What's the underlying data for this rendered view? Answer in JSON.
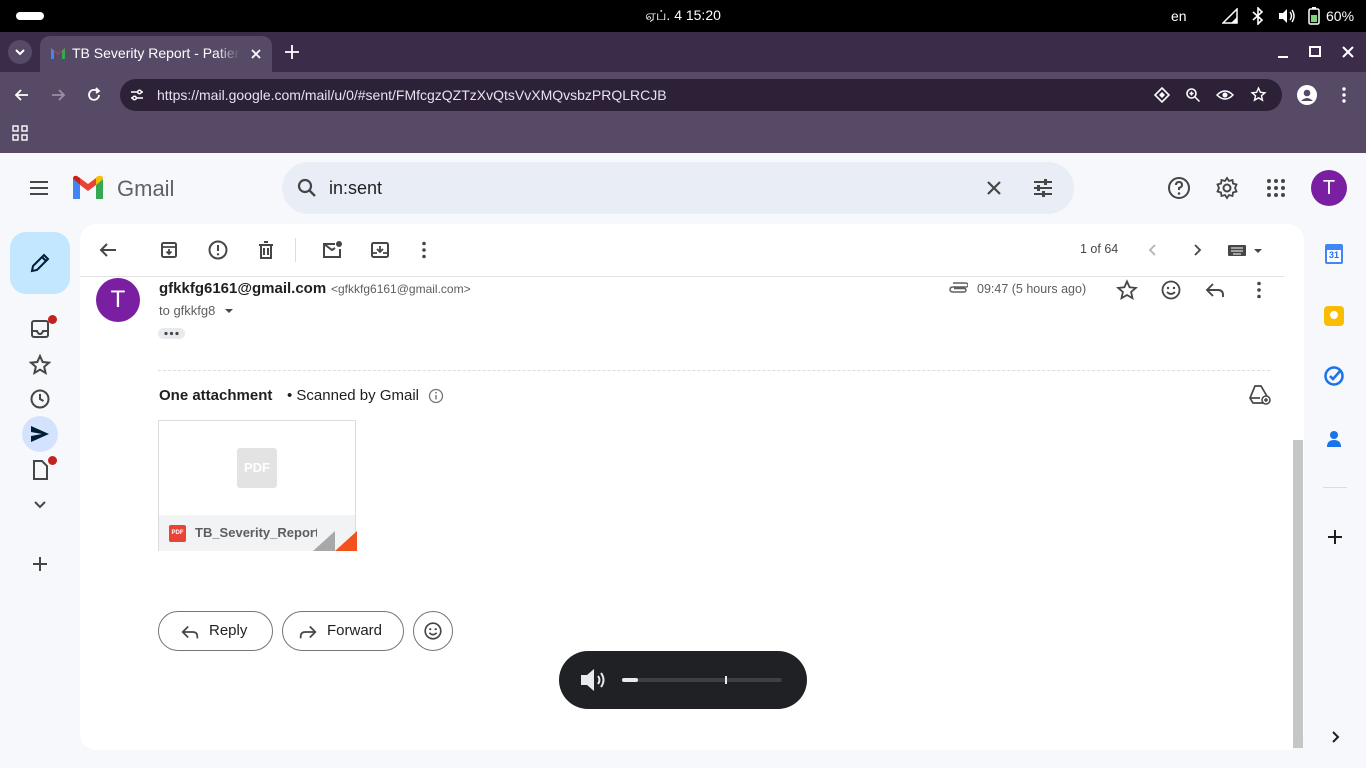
{
  "os": {
    "clock": "ஏப். 4  15:20",
    "lang": "en",
    "battery": "60%"
  },
  "browser": {
    "tab_title": "TB Severity Report - Patient",
    "url": "https://mail.google.com/mail/u/0/#sent/FMfcgzQZTzXvQtsVvXMQvsbzPRQLRCJB"
  },
  "gmail": {
    "logo_text": "Gmail",
    "search_value": "in:sent",
    "avatar_letter": "T",
    "pagination": "1 of 64"
  },
  "message": {
    "avatar_letter": "T",
    "sender_name": "gfkkfg6161@gmail.com",
    "sender_email": "<gfkkfg6161@gmail.com>",
    "to": "to gfkkfg8",
    "time": "09:47 (5 hours ago)",
    "attachment_title": "One attachment",
    "scanned": "• Scanned by Gmail",
    "attachment_name": "TB_Severity_Report.pdf",
    "pdf_badge": "PDF",
    "reply_label": "Reply",
    "forward_label": "Forward"
  },
  "calendar_day": "31",
  "volume_level": 0.1,
  "colors": {
    "avatar": "#7b1fa2",
    "compose_bg": "#c2e7ff",
    "sent_active": "#d3e3fd",
    "gmail_red": "#ea4335",
    "gmail_blue": "#4285f4",
    "gmail_green": "#34a853",
    "gmail_yellow": "#fbbc04"
  }
}
